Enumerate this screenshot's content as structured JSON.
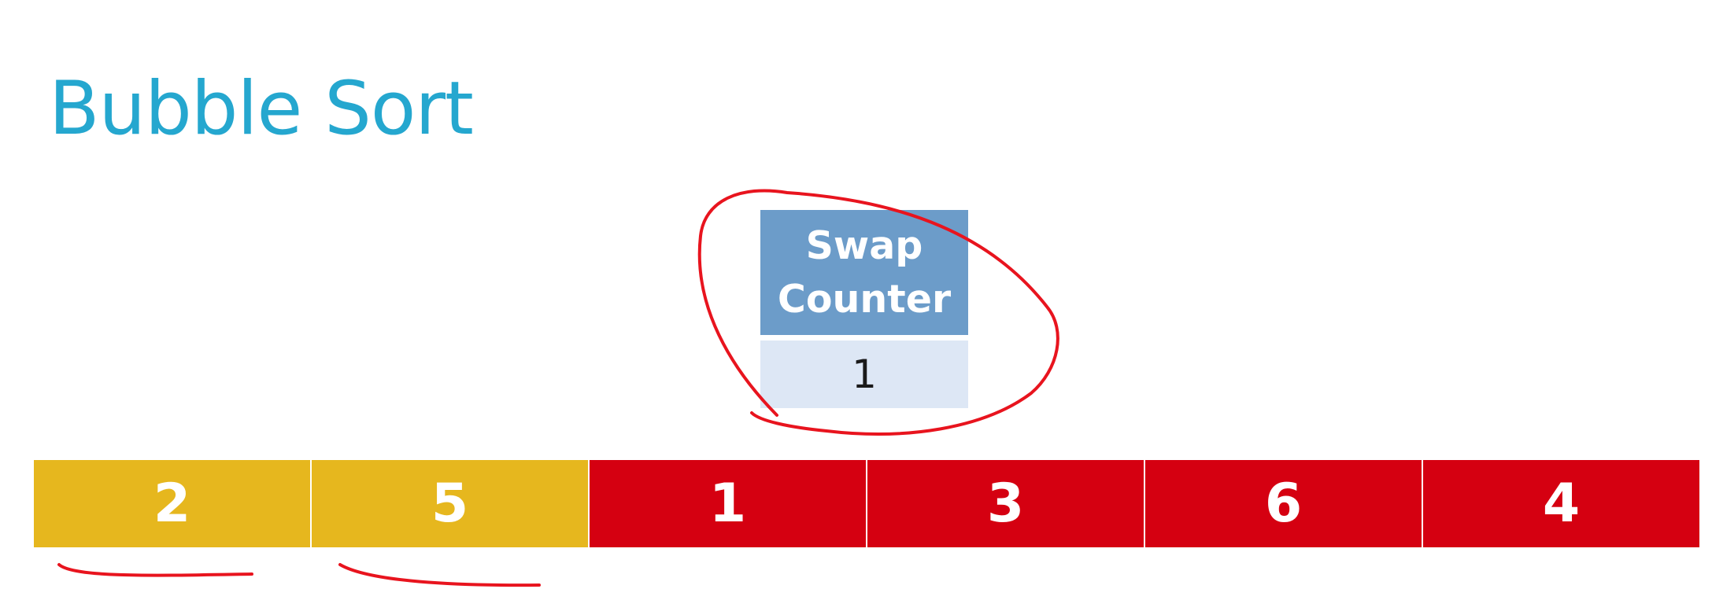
{
  "title": "Bubble Sort",
  "swap_counter": {
    "label": "Swap Counter",
    "value": "1"
  },
  "array": [
    {
      "value": "2",
      "state": "comparing",
      "color": "#e6b71e"
    },
    {
      "value": "5",
      "state": "comparing",
      "color": "#e6b71e"
    },
    {
      "value": "1",
      "state": "unsorted",
      "color": "#d50011"
    },
    {
      "value": "3",
      "state": "unsorted",
      "color": "#d50011"
    },
    {
      "value": "6",
      "state": "unsorted",
      "color": "#d50011"
    },
    {
      "value": "4",
      "state": "unsorted",
      "color": "#d50011"
    }
  ],
  "colors": {
    "title": "#25a7cf",
    "swap_header": "#6c9cc9",
    "swap_value_bg": "#dde7f5",
    "annotation": "#e8141e"
  }
}
